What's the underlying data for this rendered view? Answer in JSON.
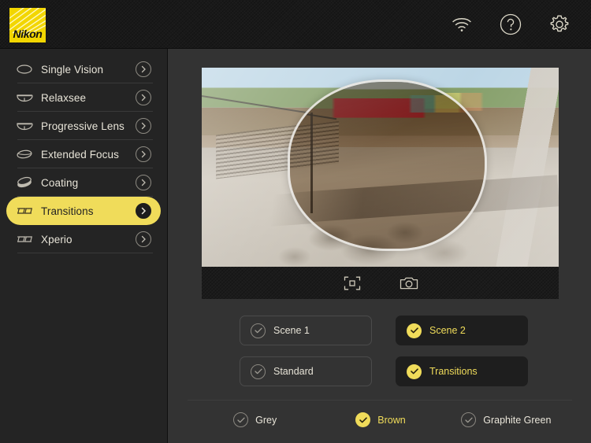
{
  "header": {
    "logo_text": "Nikon",
    "logo_color": "#F2D600",
    "icons": [
      {
        "name": "wifi-icon",
        "label": "Wi-Fi"
      },
      {
        "name": "help-icon",
        "label": "Help"
      },
      {
        "name": "gear-icon",
        "label": "Settings"
      }
    ]
  },
  "accent_color": "#F0DC5A",
  "sidebar": {
    "items": [
      {
        "label": "Single Vision",
        "icon": "lens-single-vision-icon",
        "selected": false
      },
      {
        "label": "Relaxsee",
        "icon": "lens-relaxsee-icon",
        "selected": false
      },
      {
        "label": "Progressive Lens",
        "icon": "lens-progressive-icon",
        "selected": false
      },
      {
        "label": "Extended Focus",
        "icon": "lens-extended-focus-icon",
        "selected": false
      },
      {
        "label": "Coating",
        "icon": "lens-coating-icon",
        "selected": false
      },
      {
        "label": "Transitions",
        "icon": "lens-transitions-icon",
        "selected": true
      },
      {
        "label": "Xperio",
        "icon": "lens-xperio-icon",
        "selected": false
      }
    ]
  },
  "viewer": {
    "scene_description": "Outdoor farmers market with red canopy tent, stairs and trees; brown-tinted Transitions lens overlay",
    "toolbar": [
      {
        "name": "fullscreen-icon",
        "label": "Fullscreen"
      },
      {
        "name": "camera-icon",
        "label": "Capture"
      }
    ]
  },
  "options": [
    {
      "label": "Scene 1",
      "selected": false
    },
    {
      "label": "Scene 2",
      "selected": true
    },
    {
      "label": "Standard",
      "selected": false
    },
    {
      "label": "Transitions",
      "selected": true
    }
  ],
  "tints": [
    {
      "label": "Grey",
      "selected": false
    },
    {
      "label": "Brown",
      "selected": true
    },
    {
      "label": "Graphite Green",
      "selected": false
    }
  ]
}
